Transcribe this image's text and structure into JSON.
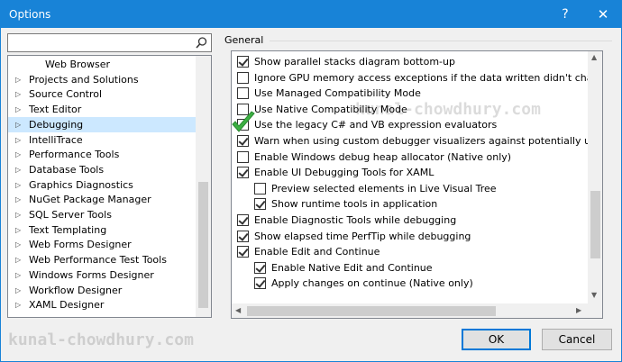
{
  "window": {
    "title": "Options",
    "help_glyph": "?",
    "close_glyph": "✕",
    "accent_color": "#1883d7"
  },
  "search": {
    "placeholder": "",
    "value": "",
    "icon": "search-icon"
  },
  "tree": {
    "items": [
      {
        "label": "Web Browser",
        "child": true,
        "selected": false
      },
      {
        "label": "Projects and Solutions",
        "child": false,
        "selected": false
      },
      {
        "label": "Source Control",
        "child": false,
        "selected": false
      },
      {
        "label": "Text Editor",
        "child": false,
        "selected": false
      },
      {
        "label": "Debugging",
        "child": false,
        "selected": true
      },
      {
        "label": "IntelliTrace",
        "child": false,
        "selected": false
      },
      {
        "label": "Performance Tools",
        "child": false,
        "selected": false
      },
      {
        "label": "Database Tools",
        "child": false,
        "selected": false
      },
      {
        "label": "Graphics Diagnostics",
        "child": false,
        "selected": false
      },
      {
        "label": "NuGet Package Manager",
        "child": false,
        "selected": false
      },
      {
        "label": "SQL Server Tools",
        "child": false,
        "selected": false
      },
      {
        "label": "Text Templating",
        "child": false,
        "selected": false
      },
      {
        "label": "Web Forms Designer",
        "child": false,
        "selected": false
      },
      {
        "label": "Web Performance Test Tools",
        "child": false,
        "selected": false
      },
      {
        "label": "Windows Forms Designer",
        "child": false,
        "selected": false
      },
      {
        "label": "Workflow Designer",
        "child": false,
        "selected": false
      },
      {
        "label": "XAML Designer",
        "child": false,
        "selected": false
      }
    ]
  },
  "general": {
    "label": "General",
    "options": [
      {
        "label": "Show parallel stacks diagram bottom-up",
        "checked": true,
        "indent": false
      },
      {
        "label": "Ignore GPU memory access exceptions if the data written didn't change the v",
        "checked": false,
        "indent": false
      },
      {
        "label": "Use Managed Compatibility Mode",
        "checked": false,
        "indent": false
      },
      {
        "label": "Use Native Compatibility Mode",
        "checked": false,
        "indent": false
      },
      {
        "label": "Use the legacy C# and VB expression evaluators",
        "checked": false,
        "indent": false
      },
      {
        "label": "Warn when using custom debugger visualizers against potentially unsafe pro",
        "checked": true,
        "indent": false
      },
      {
        "label": "Enable Windows debug heap allocator (Native only)",
        "checked": false,
        "indent": false
      },
      {
        "label": "Enable UI Debugging Tools for XAML",
        "checked": true,
        "indent": false
      },
      {
        "label": "Preview selected elements in Live Visual Tree",
        "checked": false,
        "indent": true
      },
      {
        "label": "Show runtime tools in application",
        "checked": true,
        "indent": true
      },
      {
        "label": "Enable Diagnostic Tools while debugging",
        "checked": true,
        "indent": false
      },
      {
        "label": "Show elapsed time PerfTip while debugging",
        "checked": true,
        "indent": false
      },
      {
        "label": "Enable Edit and Continue",
        "checked": true,
        "indent": false
      },
      {
        "label": "Enable Native Edit and Continue",
        "checked": true,
        "indent": true
      },
      {
        "label": "Apply changes on continue (Native only)",
        "checked": true,
        "indent": true
      }
    ]
  },
  "watermark": "kunal-chowdhury.com",
  "buttons": {
    "ok": "OK",
    "cancel": "Cancel"
  }
}
